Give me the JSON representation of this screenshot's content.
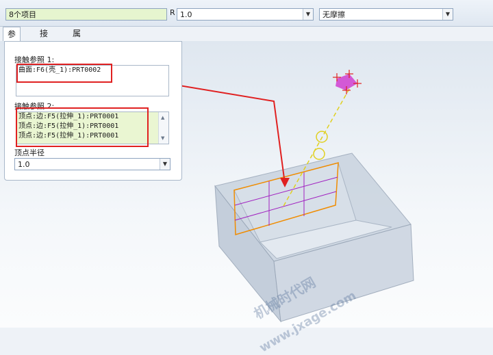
{
  "top": {
    "item_count": "8个项目",
    "r_label": "R",
    "r_value": "1.0",
    "friction": "无摩擦"
  },
  "tabs": [
    {
      "label": "参照"
    },
    {
      "label": "接触"
    },
    {
      "label": "属性"
    }
  ],
  "panel": {
    "ref1_label": "接触参照 1:",
    "ref1_items": [
      "曲面:F6(壳_1):PRT0002"
    ],
    "ref2_label": "接触参照 2:",
    "ref2_items": [
      "顶点:边:F5(拉伸_1):PRT0001",
      "顶点:边:F5(拉伸_1):PRT0001",
      "顶点:边:F5(拉伸_1):PRT0001"
    ],
    "radius_label": "顶点半径",
    "radius_value": "1.0"
  },
  "watermark": {
    "line1": "机械时代网",
    "line2": "www.jxage.com"
  }
}
